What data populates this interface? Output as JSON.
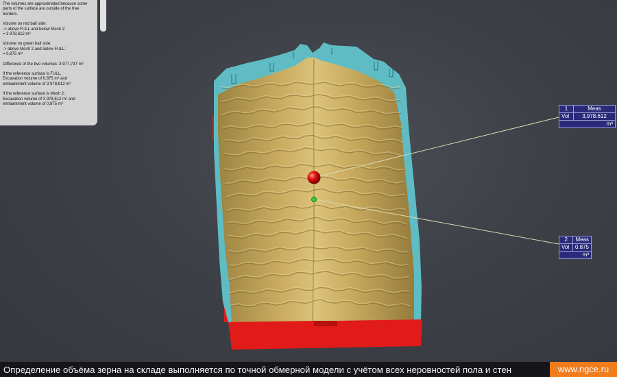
{
  "info_panel": {
    "paragraphs": [
      [
        "The volumes are approximated because some",
        "parts of the surface are outside of the free",
        "borders."
      ],
      [
        "Volume on red ball side:",
        "-> above FULL and below Mesh 2:",
        "     = 3 978,612 m³"
      ],
      [
        "Volume on green ball side:",
        "-> above Mesh 2 and below FULL:",
        "     = 0,875 m³"
      ],
      [
        "Difference of the two volumes: 3 977,737 m³"
      ],
      [
        "If the reference surface is FULL,",
        "Excavation volume of 0,875 m³ and",
        "embankment volume of 3 978,612 m³"
      ],
      [
        "If the reference surface is Mesh 2,",
        "Excavation volume of 3 978,612 m³ and",
        "embankment volume of 0,875 m³"
      ]
    ]
  },
  "callouts": [
    {
      "index": "1",
      "header": "Meas",
      "label": "Vol",
      "value": "3,978.612",
      "unit": "m³"
    },
    {
      "index": "2",
      "header": "Meas",
      "label": "Vol",
      "value": "0.875",
      "unit": "m³"
    }
  ],
  "caption": {
    "text": "Определение объёма зерна на складе выполняется по точной обмерной модели с учётом всех неровностей пола и стен",
    "site": "www.ngce.ru"
  },
  "colors": {
    "grain_surface": "#c9ab60",
    "reference_surface": "#5fbcc4",
    "red_side": "#e11a1a",
    "red_ball": "#e01010",
    "green_ball": "#2bd12b",
    "leader_line": "#d9d9b0",
    "callout_bg": "#2a2a7a",
    "caption_accent": "#f07c1c"
  }
}
